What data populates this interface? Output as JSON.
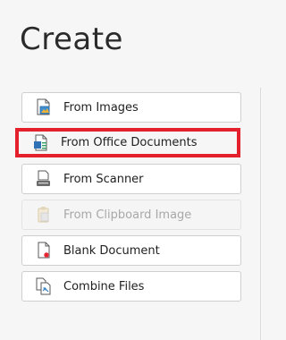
{
  "panel": {
    "title": "Create"
  },
  "buttons": [
    {
      "label": "From Images",
      "icon": "image-file-icon",
      "enabled": true
    },
    {
      "label": "From Office Documents",
      "icon": "office-document-icon",
      "enabled": true,
      "highlighted": true
    },
    {
      "label": "From Scanner",
      "icon": "scanner-icon",
      "enabled": true
    },
    {
      "label": "From Clipboard Image",
      "icon": "clipboard-icon",
      "enabled": false
    },
    {
      "label": "Blank Document",
      "icon": "blank-document-icon",
      "enabled": true
    },
    {
      "label": "Combine Files",
      "icon": "combine-files-icon",
      "enabled": true
    }
  ],
  "colors": {
    "highlight": "#e4202c",
    "button_border": "#cfcfcf",
    "background": "#f6f6f6"
  }
}
